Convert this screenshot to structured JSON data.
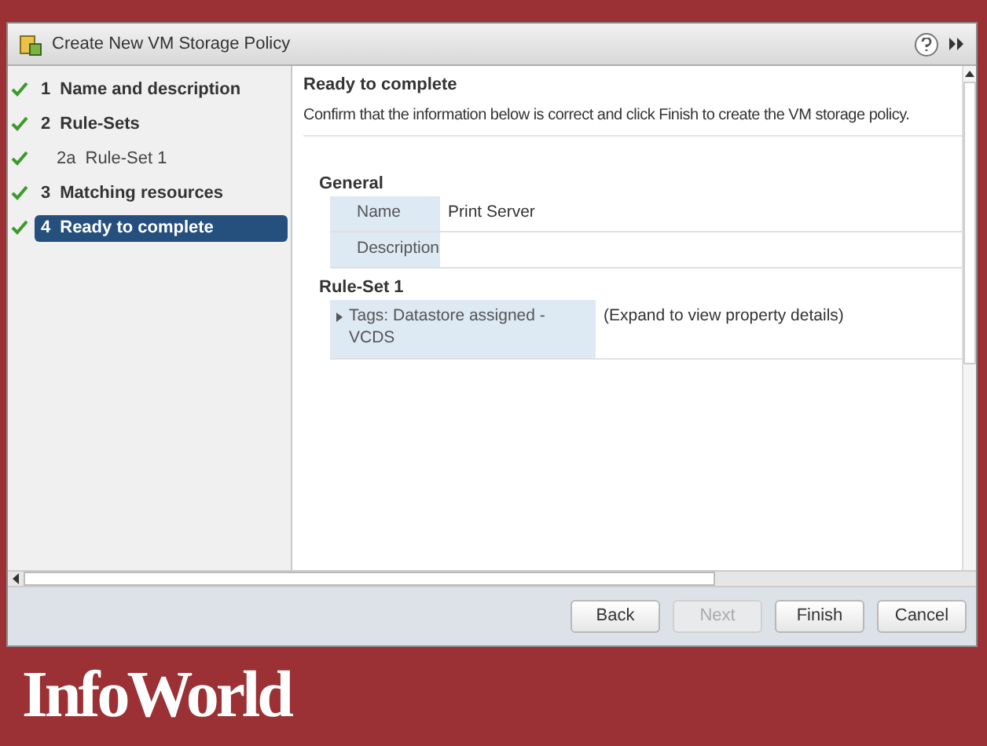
{
  "window": {
    "title": "Create New VM Storage Policy"
  },
  "steps": [
    {
      "number": "1",
      "label": "Name and description",
      "done": true,
      "selected": false
    },
    {
      "number": "2",
      "label": "Rule-Sets",
      "done": true,
      "selected": false,
      "children": [
        {
          "number": "2a",
          "label": "Rule-Set 1",
          "done": true,
          "selected": false
        }
      ]
    },
    {
      "number": "3",
      "label": "Matching resources",
      "done": true,
      "selected": false
    },
    {
      "number": "4",
      "label": "Ready to complete",
      "done": true,
      "selected": true
    }
  ],
  "page": {
    "title": "Ready to complete",
    "description": "Confirm that the information below is correct and click Finish to create the VM storage policy.",
    "sections": [
      {
        "title": "General",
        "rows": [
          {
            "expandable": false,
            "label": "Name",
            "value": "Print Server"
          },
          {
            "expandable": false,
            "label": "Description"
          }
        ]
      },
      {
        "title": "Rule-Set 1",
        "rows": [
          {
            "expandable": true,
            "label": "Tags: Datastore assigned - VCDS",
            "value": "(Expand to view property details)"
          }
        ]
      }
    ]
  },
  "buttons": [
    {
      "label": "Back",
      "disabled": false
    },
    {
      "label": "Next",
      "disabled": true
    },
    {
      "label": "Finish",
      "disabled": false
    },
    {
      "label": "Cancel",
      "disabled": false
    }
  ],
  "footer": {
    "logo": "InfoWorld"
  }
}
